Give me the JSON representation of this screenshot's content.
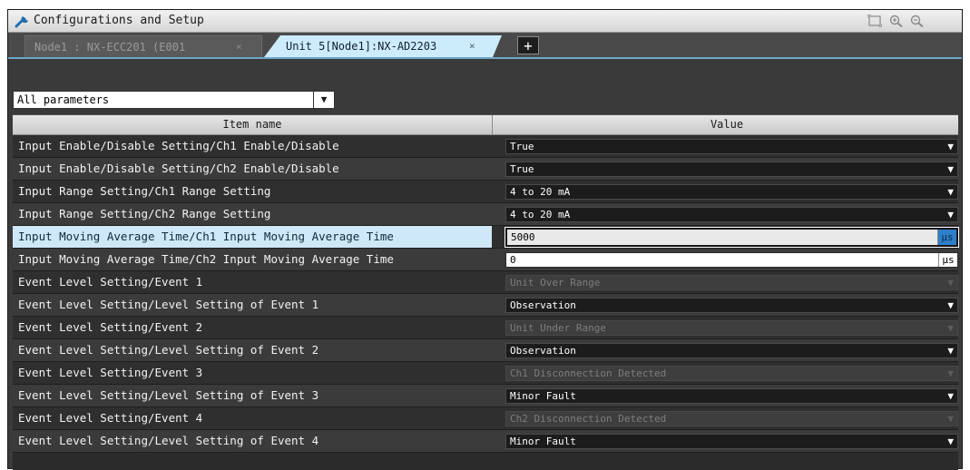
{
  "window": {
    "title": "Configurations and Setup",
    "icon": "wrench-icon",
    "controls": [
      "fit-icon",
      "zoom-in-icon",
      "zoom-out-icon"
    ]
  },
  "tabs": [
    {
      "label": "Node1 : NX-ECC201 (E001",
      "close": "×",
      "active": false
    },
    {
      "label": "Unit 5[Node1]:NX-AD2203",
      "close": "×",
      "active": true
    }
  ],
  "add_tab_label": "+",
  "filter": {
    "value": "All parameters",
    "arrow": "▼"
  },
  "grid": {
    "columns": [
      "Item name",
      "Value"
    ],
    "rows": [
      {
        "name": "Input Enable/Disable Setting/Ch1 Enable/Disable",
        "value": "True",
        "type": "dropdown",
        "enabled": true
      },
      {
        "name": "Input Enable/Disable Setting/Ch2 Enable/Disable",
        "value": "True",
        "type": "dropdown",
        "enabled": true
      },
      {
        "name": "Input Range Setting/Ch1 Range Setting",
        "value": "4 to 20 mA",
        "type": "dropdown",
        "enabled": true
      },
      {
        "name": "Input Range Setting/Ch2 Range Setting",
        "value": "4 to 20 mA",
        "type": "dropdown",
        "enabled": true
      },
      {
        "name": "Input Moving Average Time/Ch1 Input Moving Average Time",
        "value": "5000",
        "unit": "μs",
        "type": "text",
        "selected": true
      },
      {
        "name": "Input Moving Average Time/Ch2 Input Moving Average Time",
        "value": "0",
        "unit": "μs",
        "type": "text"
      },
      {
        "name": "Event Level Setting/Event 1",
        "value": "Unit Over Range",
        "type": "dropdown",
        "enabled": false
      },
      {
        "name": "Event Level Setting/Level Setting of Event 1",
        "value": "Observation",
        "type": "dropdown",
        "enabled": true
      },
      {
        "name": "Event Level Setting/Event 2",
        "value": "Unit Under Range",
        "type": "dropdown",
        "enabled": false
      },
      {
        "name": "Event Level Setting/Level Setting of Event 2",
        "value": "Observation",
        "type": "dropdown",
        "enabled": true
      },
      {
        "name": "Event Level Setting/Event 3",
        "value": "Ch1 Disconnection Detected",
        "type": "dropdown",
        "enabled": false
      },
      {
        "name": "Event Level Setting/Level Setting of Event 3",
        "value": "Minor Fault",
        "type": "dropdown",
        "enabled": true
      },
      {
        "name": "Event Level Setting/Event 4",
        "value": "Ch2 Disconnection Detected",
        "type": "dropdown",
        "enabled": false
      },
      {
        "name": "Event Level Setting/Level Setting of Event 4",
        "value": "Minor Fault",
        "type": "dropdown",
        "enabled": true
      }
    ]
  },
  "dropdown_arrow": "▼",
  "colors": {
    "window_bg": "#3a3a3a",
    "selected_row": "#cfe8f7",
    "active_tab": "#ccebfb",
    "unit_highlight": "#2e7fc9"
  }
}
